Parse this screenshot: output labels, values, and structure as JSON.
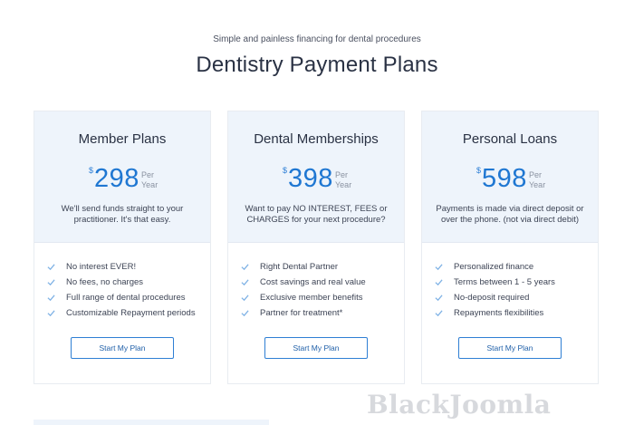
{
  "header": {
    "subtitle": "Simple and painless financing for dental procedures",
    "title": "Dentistry Payment Plans"
  },
  "plans": [
    {
      "name": "Member Plans",
      "currency": "$",
      "amount": "298",
      "per": "Per",
      "period": "Year",
      "desc_line1": "We'll send funds straight to your",
      "desc_line2": "practitioner. It's that easy.",
      "features": [
        "No interest EVER!",
        "No fees, no charges",
        "Full range of dental procedures",
        "Customizable Repayment periods"
      ],
      "button": "Start My Plan"
    },
    {
      "name": "Dental Memberships",
      "currency": "$",
      "amount": "398",
      "per": "Per",
      "period": "Year",
      "desc_line1": "Want to pay NO INTEREST, FEES or",
      "desc_line2": "CHARGES for your next procedure?",
      "features": [
        "Right Dental Partner",
        "Cost savings and real value",
        "Exclusive member benefits",
        "Partner for treatment*"
      ],
      "button": "Start My Plan"
    },
    {
      "name": "Personal Loans",
      "currency": "$",
      "amount": "598",
      "per": "Per",
      "period": "Year",
      "desc_line1": "Payments is made via direct deposit or",
      "desc_line2": "over the phone. (not via direct debit)",
      "features": [
        "Personalized finance",
        "Terms between 1 - 5 years",
        "No-deposit required",
        "Repayments flexibilities"
      ],
      "button": "Start My Plan"
    }
  ],
  "watermark": "BlackJoomla",
  "colors": {
    "accent": "#1f77d2",
    "card_top": "#eef4fb",
    "check": "#7fb2e5"
  }
}
